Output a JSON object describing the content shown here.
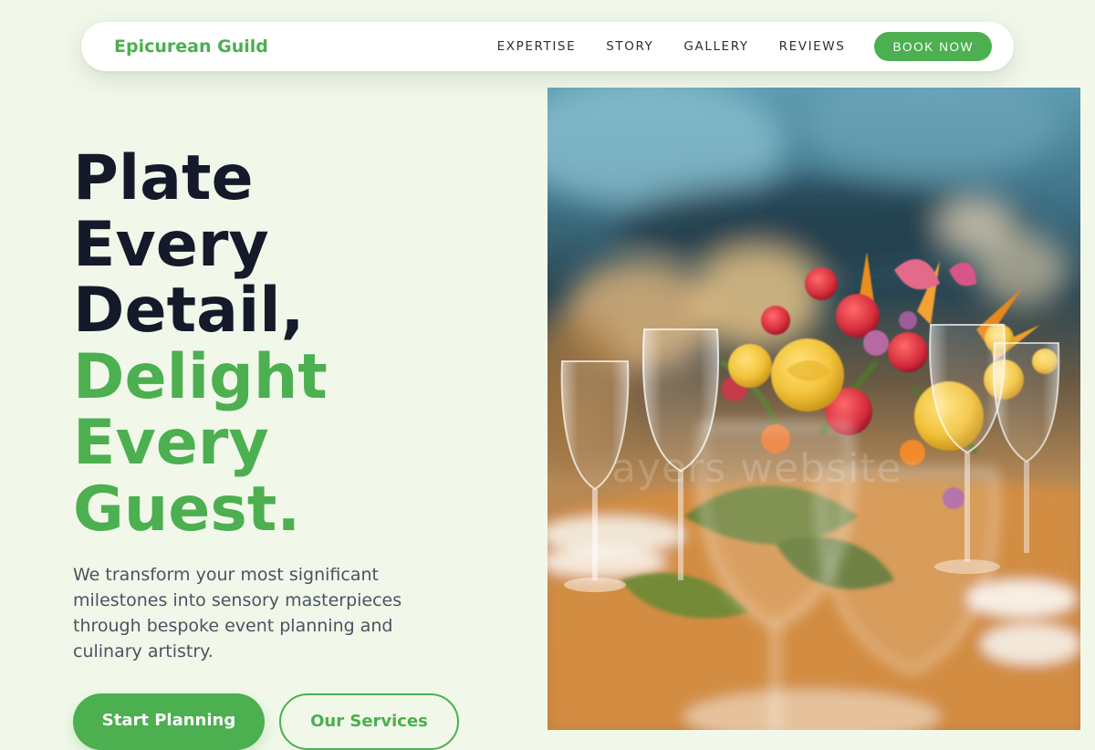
{
  "nav": {
    "brand": "Epicurean Guild",
    "links": [
      "EXPERTISE",
      "STORY",
      "GALLERY",
      "REVIEWS"
    ],
    "cta": "BOOK NOW"
  },
  "hero": {
    "title_lines_dark": [
      "Plate",
      "Every",
      "Detail,"
    ],
    "title_lines_green": [
      "Delight",
      "Every",
      "Guest."
    ],
    "description": "We transform your most significant milestones into sensory masterpieces through bespoke event planning and culinary artistry.",
    "primary_button": "Start Planning",
    "secondary_button": "Our Services"
  },
  "image": {
    "alt": "Elegant dinner table with floral centerpiece and wine glasses",
    "watermark": "ayers website"
  },
  "colors": {
    "accent": "#4caf50",
    "heading": "#141a2a",
    "body_text": "#4a5361",
    "page_background": "#f1f8ea"
  }
}
